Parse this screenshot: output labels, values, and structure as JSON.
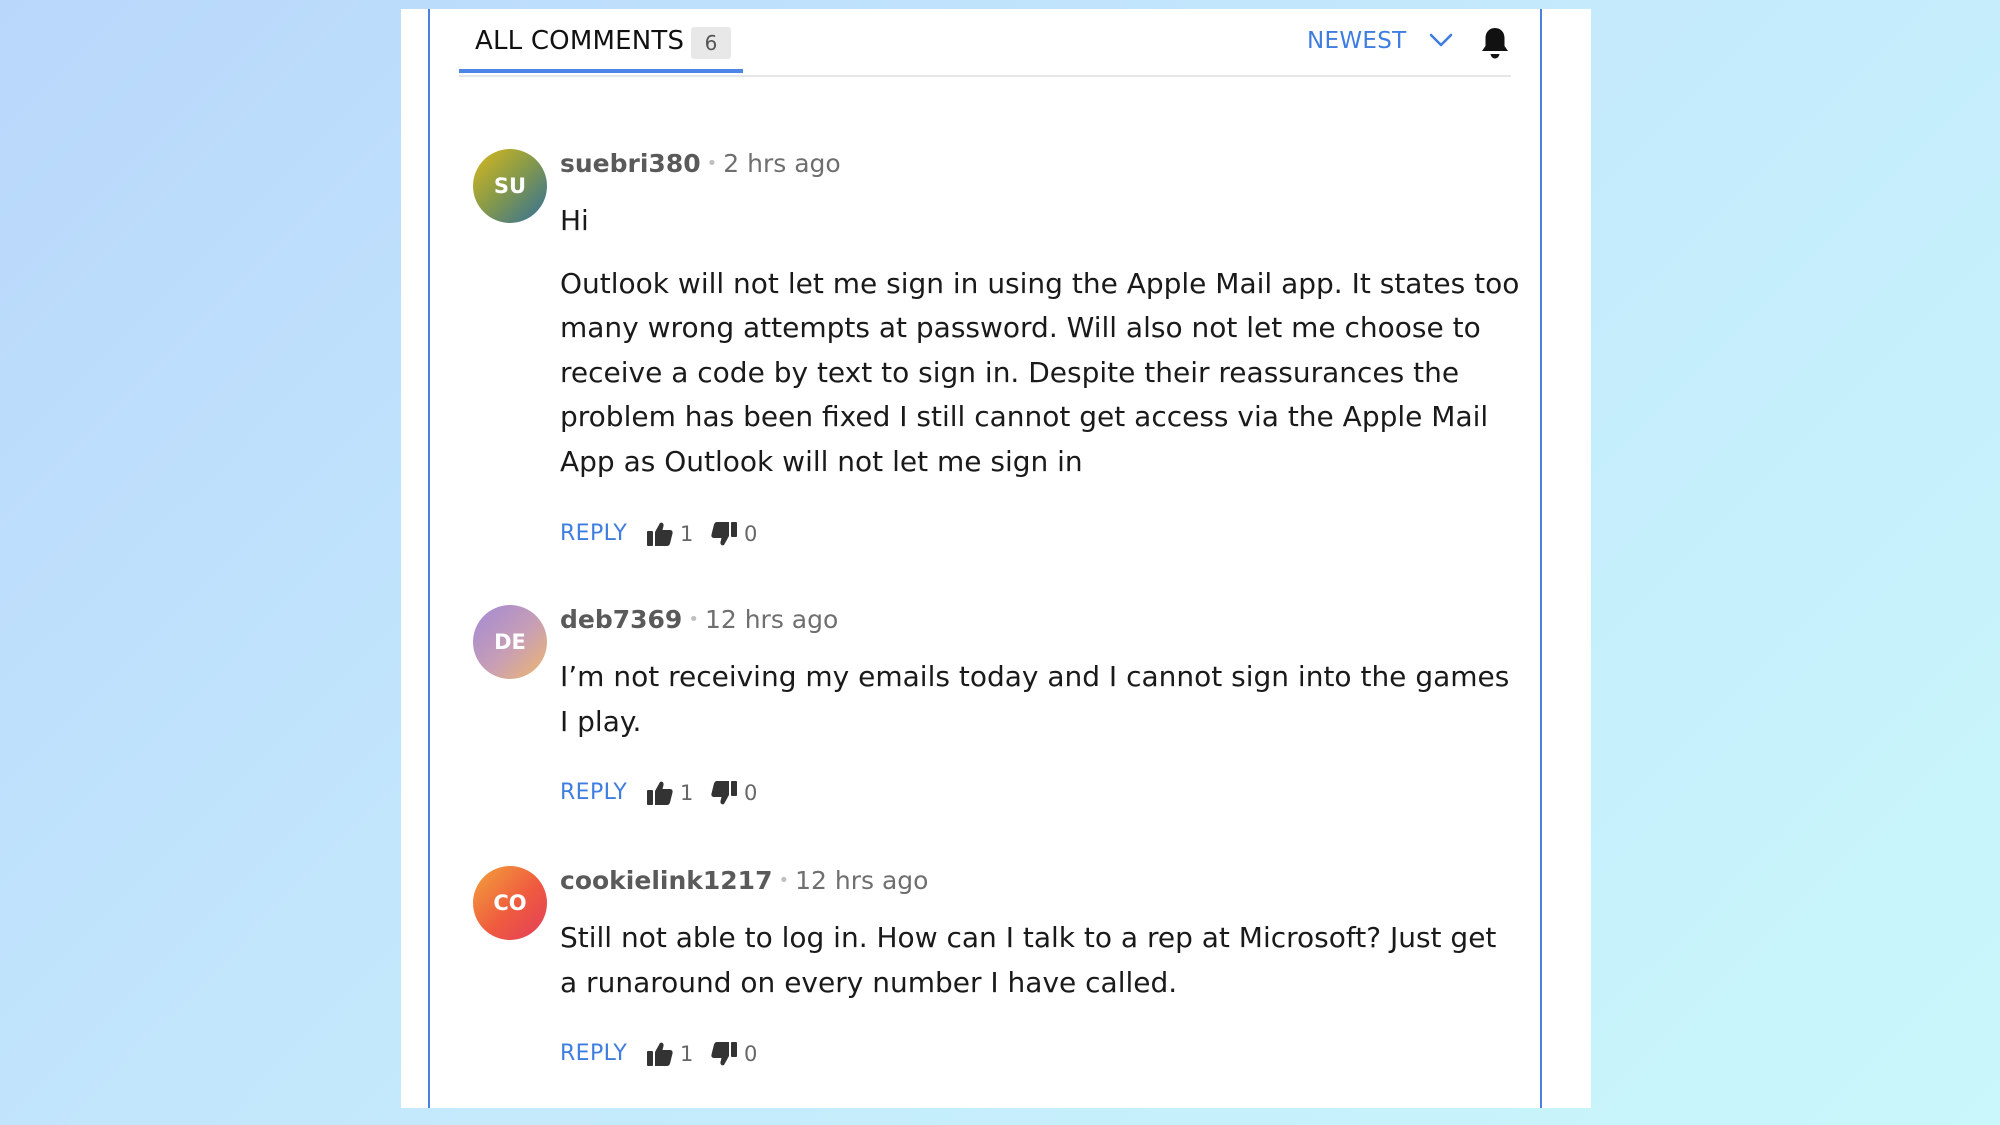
{
  "comments_header": {
    "all_comments_label": "ALL COMMENTS",
    "count": "6",
    "sort_label": "NEWEST"
  },
  "icons": {
    "sort": "chevron-down-icon",
    "notifications": "bell-icon",
    "upvote": "thumbs-up-icon",
    "downvote": "thumbs-down-icon"
  },
  "colors": {
    "accent": "#3f7ee0",
    "frame": "#4b80e0",
    "background_start": "#b9d7fb",
    "background_end": "#c9f7fb"
  },
  "comments": [
    {
      "initials": "SU",
      "username": "suebri380",
      "separator": "•",
      "timestamp": "2 hrs ago",
      "paragraphs": [
        "Hi",
        "Outlook will not let me sign in using the Apple Mail app. It states too many wrong attempts at password. Will also not let me choose to receive a code by text to sign in. Despite their reassurances the problem has been fixed I still cannot get access via the Apple Mail App as Outlook will not let me sign in"
      ],
      "reply_label": "REPLY",
      "upvotes": "1",
      "downvotes": "0"
    },
    {
      "initials": "DE",
      "username": "deb7369",
      "separator": "•",
      "timestamp": "12 hrs ago",
      "paragraphs": [
        "I’m not receiving my emails today and I cannot sign into the games I play."
      ],
      "reply_label": "REPLY",
      "upvotes": "1",
      "downvotes": "0"
    },
    {
      "initials": "CO",
      "username": "cookielink1217",
      "separator": "•",
      "timestamp": "12 hrs ago",
      "paragraphs": [
        "Still not able to log in. How can I talk to a rep at Microsoft? Just get a runaround on every number I have called."
      ],
      "reply_label": "REPLY",
      "upvotes": "1",
      "downvotes": "0"
    }
  ]
}
